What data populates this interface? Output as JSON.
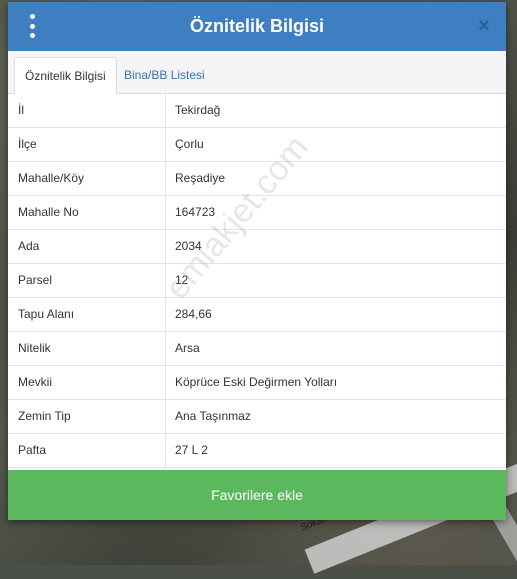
{
  "header": {
    "title": "Öznitelik Bilgisi",
    "close_label": "×"
  },
  "tabs": [
    {
      "label": "Öznitelik Bilgisi",
      "active": true
    },
    {
      "label": "Bina/BB Listesi",
      "active": false
    }
  ],
  "rows": [
    {
      "key": "İl",
      "value": "Tekirdağ"
    },
    {
      "key": "İlçe",
      "value": "Çorlu"
    },
    {
      "key": "Mahalle/Köy",
      "value": "Reşadiye"
    },
    {
      "key": "Mahalle No",
      "value": "164723"
    },
    {
      "key": "Ada",
      "value": "2034"
    },
    {
      "key": "Parsel",
      "value": "12"
    },
    {
      "key": "Tapu Alanı",
      "value": "284,66"
    },
    {
      "key": "Nitelik",
      "value": "Arsa"
    },
    {
      "key": "Mevkii",
      "value": "Köprüce Eski Değirmen Yolları"
    },
    {
      "key": "Zemin Tip",
      "value": "Ana Taşınmaz"
    },
    {
      "key": "Pafta",
      "value": "27 L 2"
    }
  ],
  "footer": {
    "favorite_label": "Favorilere ekle"
  },
  "map": {
    "road_label": "Sokak"
  },
  "watermark": "emlakjet.com",
  "colors": {
    "header": "#3e7ec1",
    "button": "#5cb85c",
    "tab_link": "#3a72b0"
  }
}
